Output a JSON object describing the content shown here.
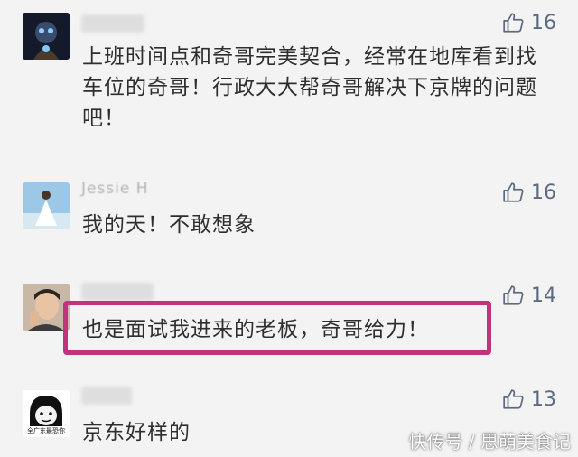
{
  "comments": [
    {
      "name": "",
      "likes": "16",
      "text": "上班时间点和奇哥完美契合，经常在地库看到找车位的奇哥！行政大大帮奇哥解决下京牌的问题吧！",
      "avatar_icon": "robot-avatar-icon"
    },
    {
      "name": "Jessie H",
      "likes": "16",
      "text": "我的天！不敢想象",
      "avatar_icon": "woman-dress-avatar-icon"
    },
    {
      "name": "",
      "likes": "14",
      "text": "也是面试我进来的老板，奇哥给力！",
      "avatar_icon": "man-photo-avatar-icon"
    },
    {
      "name": "",
      "likes": "13",
      "text": "京东好样的",
      "avatar_icon": "meme-face-avatar-icon",
      "avatar_caption": "全广东最恐你"
    }
  ],
  "watermark": "快传号 / 思萌美食记",
  "colors": {
    "highlight": "#c1347b",
    "like": "#5d6b80",
    "background": "#f3f3f3"
  }
}
